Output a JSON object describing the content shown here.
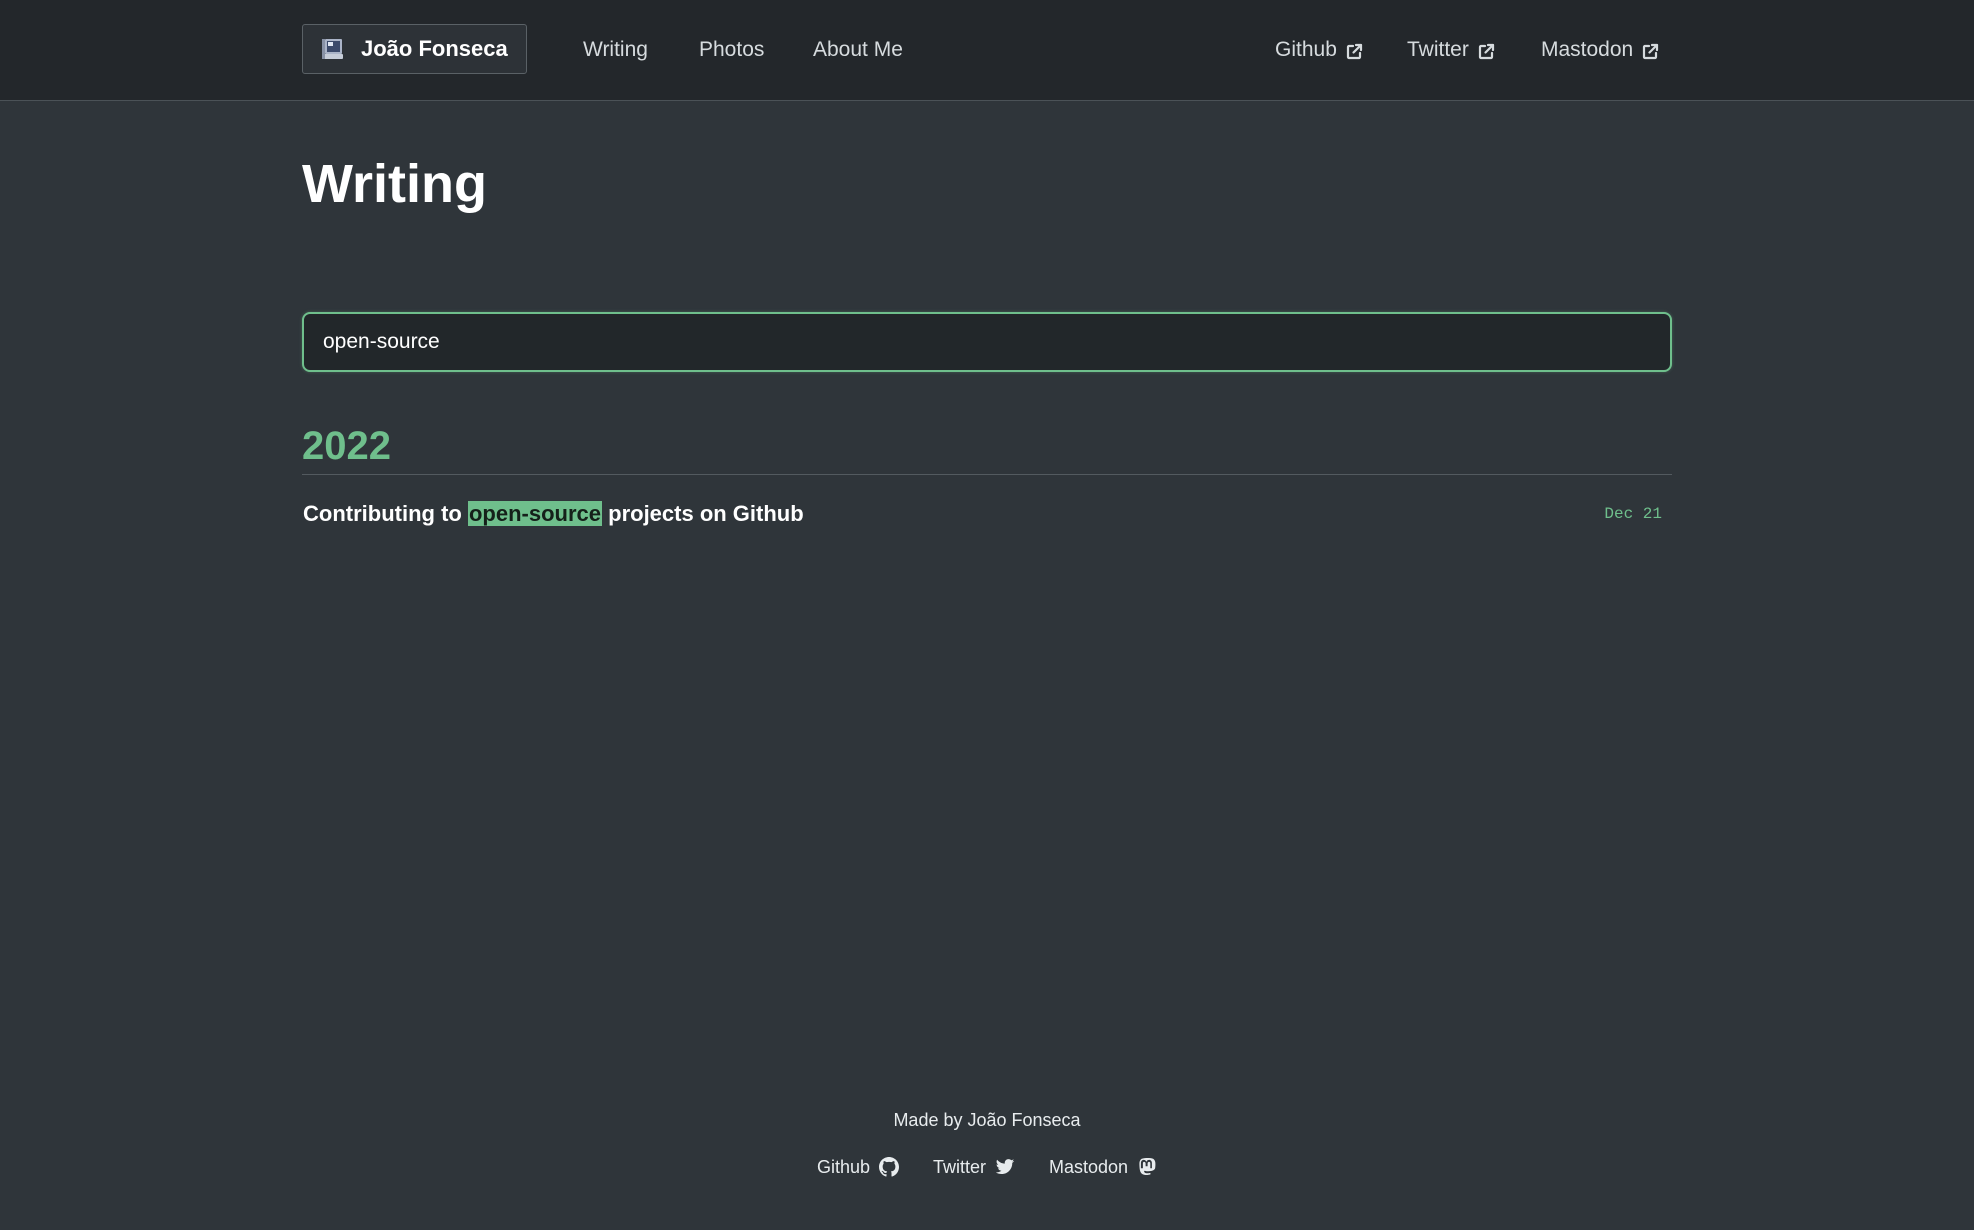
{
  "header": {
    "brand": "João Fonseca",
    "nav": [
      "Writing",
      "Photos",
      "About Me"
    ],
    "external": [
      "Github",
      "Twitter",
      "Mastodon"
    ]
  },
  "main": {
    "title": "Writing",
    "search": {
      "value": "open-source"
    },
    "groups": [
      {
        "year": "2022",
        "posts": [
          {
            "title_before": "Contributing to",
            "title_match": "open-source",
            "title_after": "projects on Github",
            "date": "Dec 21"
          }
        ]
      }
    ]
  },
  "footer": {
    "credit": "Made by João Fonseca",
    "links": [
      "Github",
      "Twitter",
      "Mastodon"
    ]
  },
  "colors": {
    "accent": "#6fbf8c",
    "background": "#2f353a",
    "header_background": "#23272b"
  },
  "icons": {
    "brand": "laptop-icon",
    "external": "external-link-icon",
    "footer": [
      "github-icon",
      "twitter-icon",
      "mastodon-icon"
    ]
  }
}
